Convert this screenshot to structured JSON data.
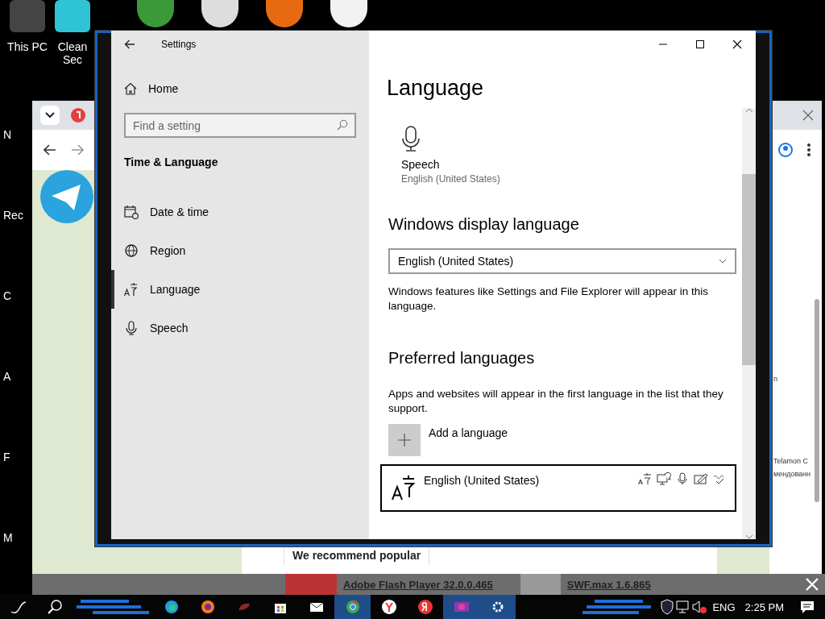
{
  "desktop": {
    "top_icons": [
      {
        "label": "This PC",
        "color": "#444444"
      },
      {
        "label": "Clean Sec",
        "color": "#2ec4d6"
      }
    ],
    "edge_labels": [
      "N",
      "Rec",
      "C",
      "A",
      "F",
      "M"
    ]
  },
  "browser": {
    "section_title": "We recommend popular",
    "items": [
      {
        "title": "Adobe Flash Player 32.0.0.465"
      },
      {
        "title": "SWF.max 1.6.865"
      }
    ],
    "side_texts": [
      "n",
      "Telamon C",
      "мендованн"
    ]
  },
  "settings": {
    "title": "Settings",
    "home": "Home",
    "search": {
      "placeholder": "Find a setting"
    },
    "category": "Time & Language",
    "nav": [
      {
        "kind": "clock",
        "label": "Date & time",
        "selected": false
      },
      {
        "kind": "globe",
        "label": "Region",
        "selected": false
      },
      {
        "kind": "language",
        "label": "Language",
        "selected": true
      },
      {
        "kind": "mic",
        "label": "Speech",
        "selected": false
      }
    ],
    "page_title": "Language",
    "speech_tile": {
      "label": "Speech",
      "value": "English (United States)"
    },
    "display_language": {
      "heading": "Windows display language",
      "value": "English (United States)",
      "note": "Windows features like Settings and File Explorer will appear in this language."
    },
    "preferred": {
      "heading": "Preferred languages",
      "note": "Apps and websites will appear in the first language in the list that they support.",
      "add_label": "Add a language",
      "languages": [
        {
          "name": "English (United States)",
          "selected": true
        }
      ]
    }
  },
  "taskbar": {
    "language": "ENG",
    "time": "2:25 PM"
  }
}
